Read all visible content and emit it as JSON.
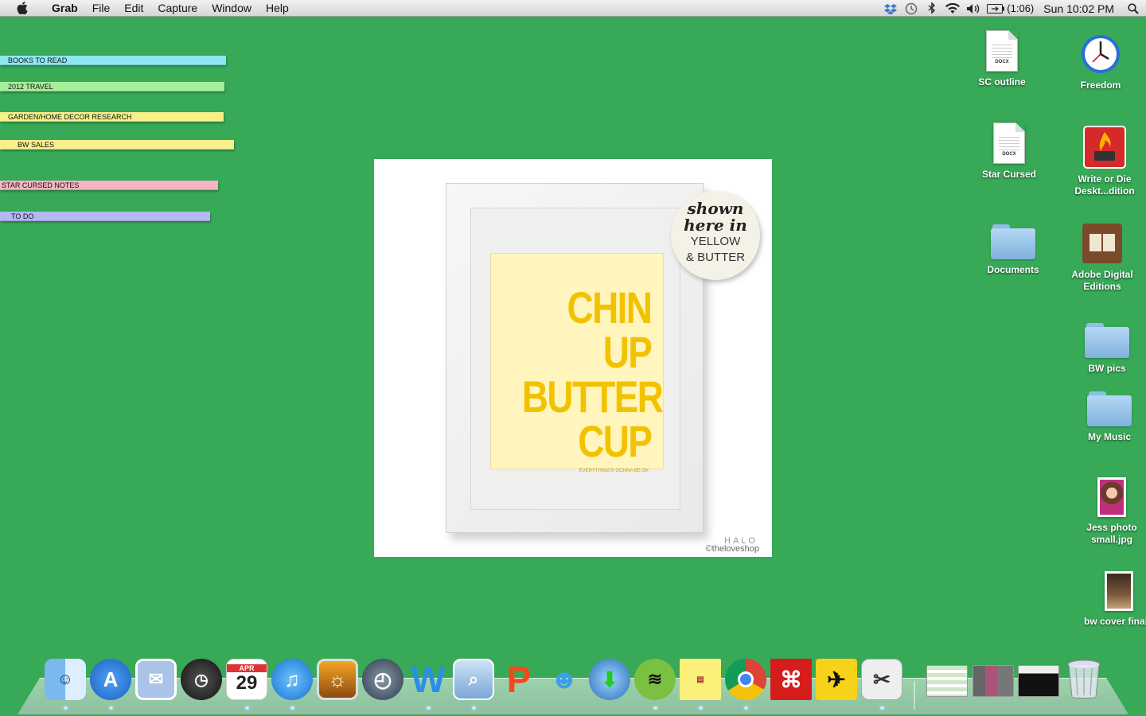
{
  "menubar": {
    "apple_icon": "apple-icon",
    "app_name": "Grab",
    "items": [
      "File",
      "Edit",
      "Capture",
      "Window",
      "Help"
    ],
    "status_icons": [
      "dropbox-icon",
      "time-machine-icon",
      "bluetooth-icon",
      "wifi-icon",
      "volume-icon"
    ],
    "battery": "(1:06)",
    "clock": "Sun 10:02 PM",
    "spotlight_icon": "spotlight-search-icon"
  },
  "stickies": [
    {
      "label": "BOOKS TO READ",
      "color": "#8fe6f3"
    },
    {
      "label": "2012 TRAVEL",
      "color": "#a6ef9a"
    },
    {
      "label": "GARDEN/HOME DECOR RESEARCH",
      "color": "#f6f08a"
    },
    {
      "label": "BW SALES",
      "color": "#f6f08a"
    },
    {
      "label": "STAR CURSED NOTES",
      "color": "#f6b3c3"
    },
    {
      "label": "TO DO",
      "color": "#b5b8f3"
    }
  ],
  "poster": {
    "lines": [
      "CHIN UP",
      "BUTTER",
      "CUP"
    ],
    "tagline": "EVERYTHING'S GONNA BE OK",
    "seal_script": [
      "shown",
      "here in"
    ],
    "seal_plain": [
      "YELLOW",
      "& BUTTER"
    ],
    "brand_top": "HALO",
    "brand_bottom": "©theloveshop",
    "print_color": "#f2c200",
    "print_bg": "#fff5bd"
  },
  "desktop_icons": [
    {
      "label": "SC outline",
      "type": "docx",
      "ext": "DOCX"
    },
    {
      "label": "Freedom",
      "type": "app"
    },
    {
      "label": "Star Cursed",
      "type": "docx",
      "ext": "DOCX"
    },
    {
      "label": "Write or Die Deskt...dition",
      "type": "app"
    },
    {
      "label": "Documents",
      "type": "folder"
    },
    {
      "label": "Adobe Digital Editions",
      "type": "app"
    },
    {
      "label": "BW pics",
      "type": "folder"
    },
    {
      "label": "My Music",
      "type": "folder"
    },
    {
      "label": "Jess photo small.jpg",
      "type": "image"
    },
    {
      "label": "bw cover final",
      "type": "image"
    }
  ],
  "dock": [
    "finder-icon",
    "app-store-icon",
    "mail-icon",
    "dashboard-icon",
    "calendar-icon",
    "itunes-icon",
    "iphoto-icon",
    "time-machine-icon",
    "word-icon",
    "preview-icon",
    "powerpoint-icon",
    "messenger-icon",
    "downloader-icon",
    "spotify-icon",
    "stickies-icon",
    "chrome-icon",
    "acrobat-icon",
    "tweet-icon",
    "grab-icon",
    "window-thumb-1",
    "window-thumb-2",
    "window-thumb-3",
    "trash-icon"
  ],
  "calendar": {
    "month": "APR",
    "day": "29"
  }
}
